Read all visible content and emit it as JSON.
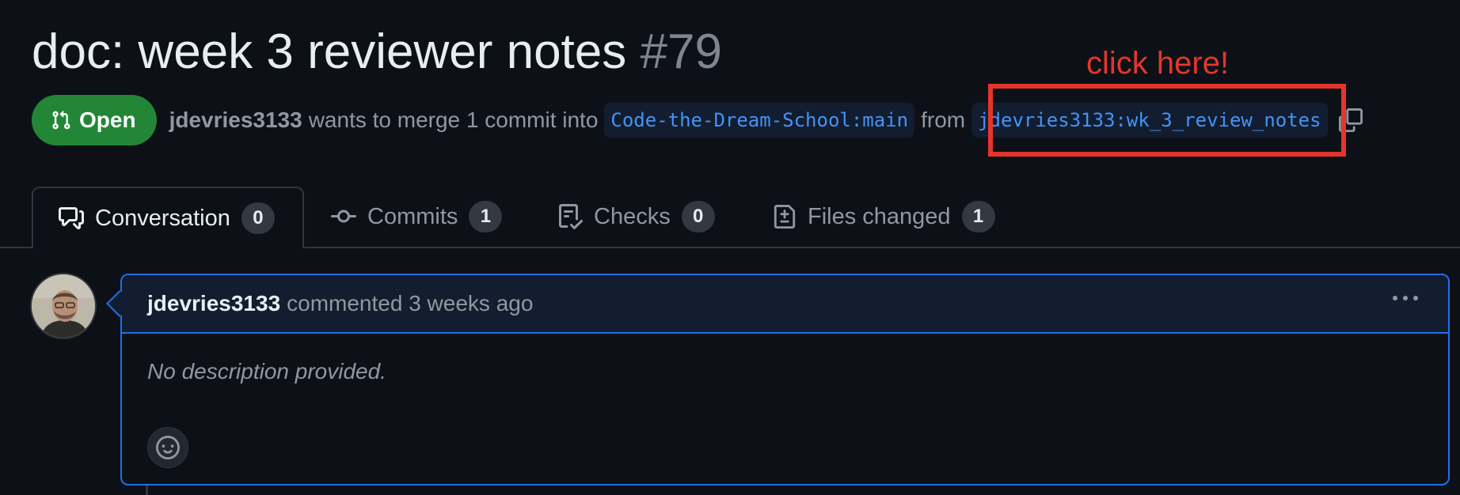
{
  "pull_request": {
    "title": "doc: week 3 reviewer notes",
    "number": "#79",
    "state": "Open",
    "author": "jdevries3133",
    "merge_text": "wants to merge 1 commit into",
    "base_branch": "Code-the-Dream-School:main",
    "from_text": "from",
    "head_branch": "jdevries3133:wk_3_review_notes"
  },
  "annotation": {
    "text": "click here!",
    "color": "#e5352b"
  },
  "tabs": [
    {
      "label": "Conversation",
      "count": "0",
      "icon": "comment-discussion-icon",
      "active": true
    },
    {
      "label": "Commits",
      "count": "1",
      "icon": "git-commit-icon",
      "active": false
    },
    {
      "label": "Checks",
      "count": "0",
      "icon": "checklist-icon",
      "active": false
    },
    {
      "label": "Files changed",
      "count": "1",
      "icon": "file-diff-icon",
      "active": false
    }
  ],
  "comment": {
    "author": "jdevries3133",
    "action": "commented 3 weeks ago",
    "body": "No description provided."
  },
  "colors": {
    "background": "#0d1117",
    "open_green": "#238636",
    "link_blue": "#4493f8",
    "comment_border": "#1f6feb"
  }
}
